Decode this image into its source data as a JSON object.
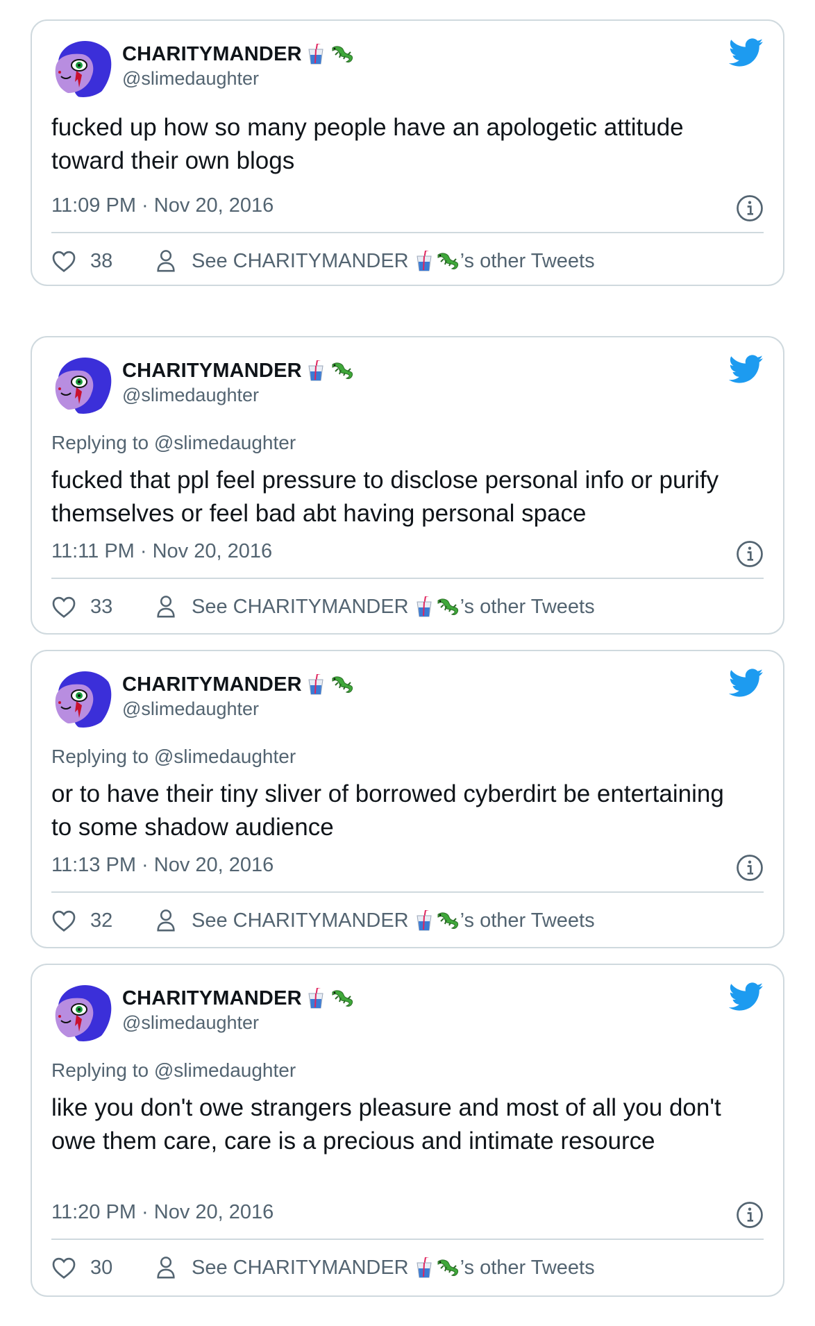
{
  "accent_color": "#1d9bf0",
  "muted_color": "#536471",
  "border_color": "#cfd9de",
  "icons": {
    "logo": "twitter-bird-icon",
    "like": "heart-icon",
    "profile": "person-icon",
    "info": "info-icon",
    "name_emoji_1": "cup-with-straw-emoji",
    "name_emoji_2": "lizard-emoji"
  },
  "tweets": [
    {
      "author_name": "CHARITYMANDER",
      "author_handle": "@slimedaughter",
      "replying_to": "",
      "text": "fucked up how so many people have an apologetic attitude toward their own blogs",
      "timestamp": "11:09 PM · Nov 20, 2016",
      "likes": "38",
      "see_prefix": "See CHARITYMANDER",
      "see_suffix": "’s other Tweets"
    },
    {
      "author_name": "CHARITYMANDER",
      "author_handle": "@slimedaughter",
      "replying_to": "Replying to @slimedaughter",
      "text": "fucked that ppl feel pressure to disclose personal info or purify themselves or feel bad abt having personal space",
      "timestamp": "11:11 PM · Nov 20, 2016",
      "likes": "33",
      "see_prefix": "See CHARITYMANDER",
      "see_suffix": "’s other Tweets"
    },
    {
      "author_name": "CHARITYMANDER",
      "author_handle": "@slimedaughter",
      "replying_to": "Replying to @slimedaughter",
      "text": "or to have their tiny sliver of borrowed cyberdirt be entertaining to some shadow audience",
      "timestamp": "11:13 PM · Nov 20, 2016",
      "likes": "32",
      "see_prefix": "See CHARITYMANDER",
      "see_suffix": "’s other Tweets"
    },
    {
      "author_name": "CHARITYMANDER",
      "author_handle": "@slimedaughter",
      "replying_to": "Replying to @slimedaughter",
      "text": "like you don't owe strangers pleasure and most of all you don't owe them care, care is a precious and intimate resource",
      "timestamp": "11:20 PM · Nov 20, 2016",
      "likes": "30",
      "see_prefix": "See CHARITYMANDER",
      "see_suffix": "’s other Tweets"
    }
  ]
}
